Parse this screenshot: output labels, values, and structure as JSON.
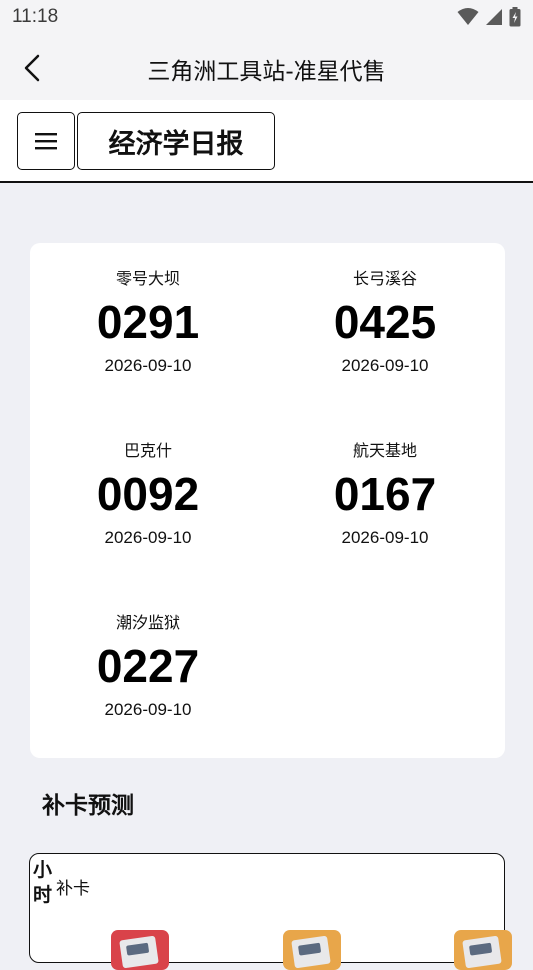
{
  "status_bar": {
    "time": "11:18",
    "icons": [
      "wifi-icon",
      "signal-icon",
      "battery-icon"
    ]
  },
  "app_bar": {
    "back_icon": "back-arrow-icon",
    "title": "三角洲工具站-准星代售"
  },
  "toolbar": {
    "menu_icon": "hamburger-menu-icon",
    "tab_label": "经济学日报"
  },
  "codes": [
    {
      "map": "零号大坝",
      "code": "0291",
      "date": "2026-09-10"
    },
    {
      "map": "长弓溪谷",
      "code": "0425",
      "date": "2026-09-10"
    },
    {
      "map": "巴克什",
      "code": "0092",
      "date": "2026-09-10"
    },
    {
      "map": "航天基地",
      "code": "0167",
      "date": "2026-09-10"
    },
    {
      "map": "潮汐监狱",
      "code": "0227",
      "date": "2026-09-10"
    }
  ],
  "forecast": {
    "section_title": "补卡预测",
    "hours_label": "小时",
    "card_label": "补卡",
    "thumb_colors": [
      "#d9434a",
      "#e8a64a",
      "#e8a64a"
    ]
  },
  "colors": {
    "background": "#eff0f5",
    "card": "#ffffff",
    "text": "#111111"
  }
}
